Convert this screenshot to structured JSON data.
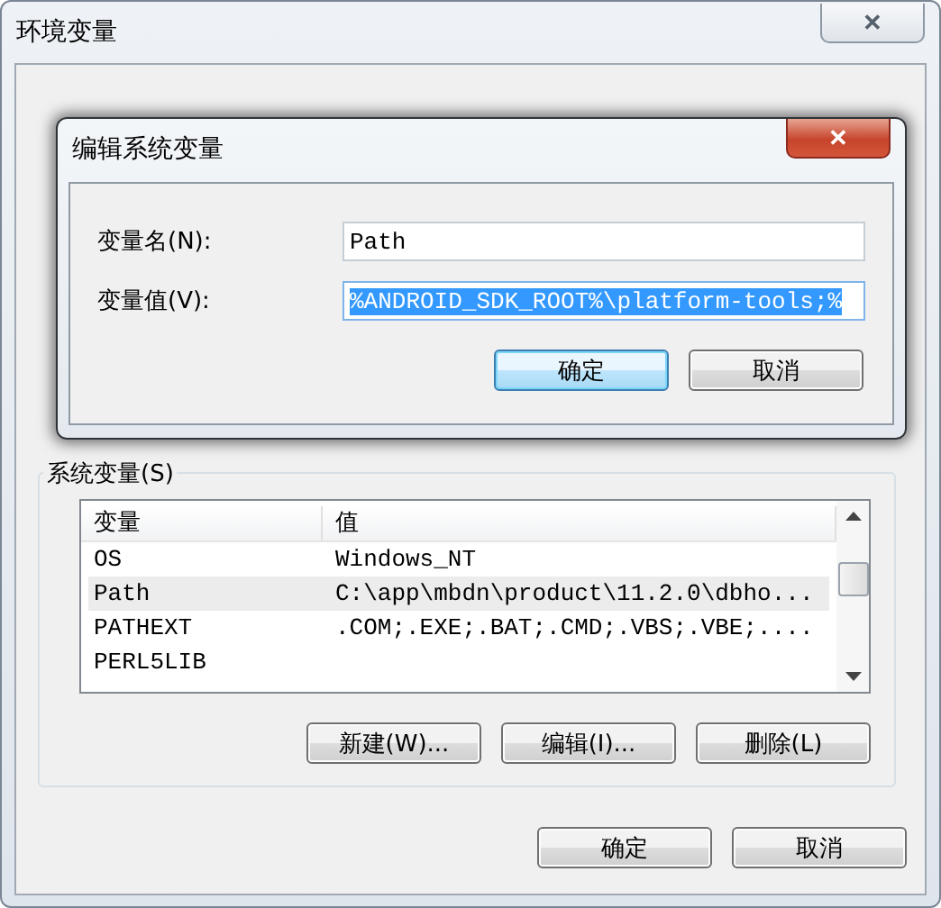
{
  "window": {
    "title": "环境变量",
    "close": "✕"
  },
  "dialog": {
    "title": "编辑系统变量",
    "close": "✕",
    "fields": [
      {
        "label": "变量名(N):",
        "value": "Path",
        "selected": false
      },
      {
        "label": "变量值(V):",
        "value": "%ANDROID_SDK_ROOT%\\platform-tools;%",
        "selected": true
      }
    ],
    "buttons": [
      {
        "label": "确定",
        "default": true
      },
      {
        "label": "取消",
        "default": false
      }
    ]
  },
  "system_variables": {
    "title": "系统变量(S)",
    "columns": [
      "变量",
      "值"
    ],
    "rows": [
      {
        "cells": [
          "OS",
          "Windows_NT"
        ],
        "selected": false
      },
      {
        "cells": [
          "Path",
          "C:\\app\\mbdn\\product\\11.2.0\\dbho..."
        ],
        "selected": true
      },
      {
        "cells": [
          "PATHEXT",
          ".COM;.EXE;.BAT;.CMD;.VBS;.VBE;...."
        ],
        "selected": false
      },
      {
        "cells": [
          "PERL5LIB",
          ""
        ],
        "selected": false
      }
    ],
    "buttons": [
      "新建(W)...",
      "编辑(I)...",
      "删除(L)"
    ]
  },
  "buttons": [
    {
      "label": "确定",
      "default": false
    },
    {
      "label": "取消",
      "default": false
    }
  ]
}
